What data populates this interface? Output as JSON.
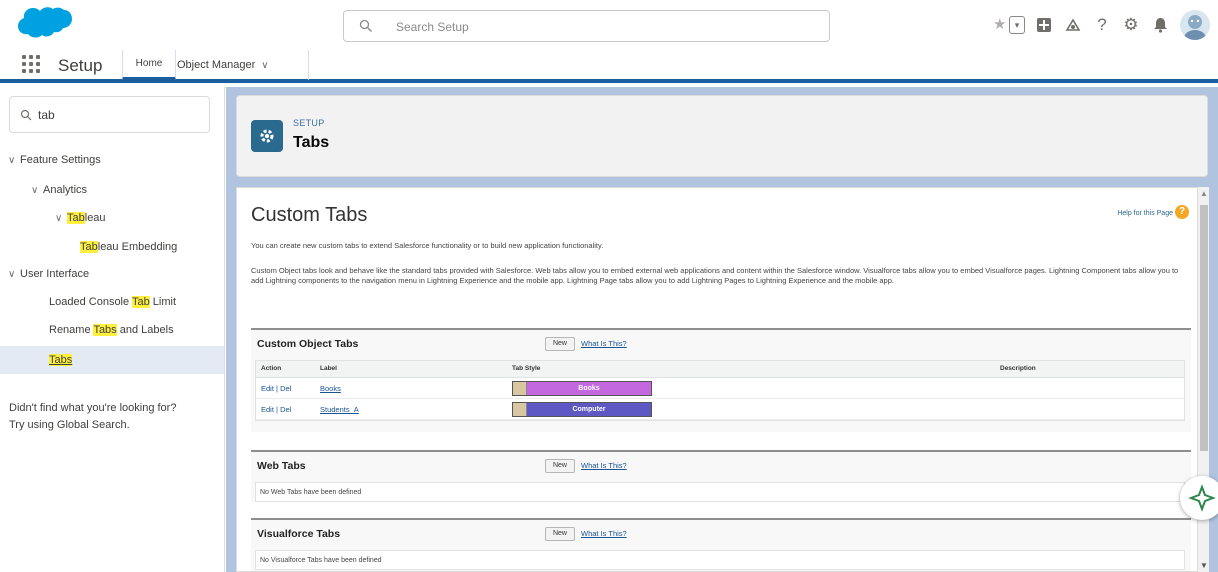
{
  "header": {
    "search_placeholder": "Search Setup",
    "icons": [
      "favorites-star-icon",
      "favorites-dropdown-icon",
      "global-actions-icon",
      "trailhead-icon",
      "help-icon",
      "setup-gear-icon",
      "notifications-bell-icon",
      "user-avatar"
    ]
  },
  "nav": {
    "app_name": "Setup",
    "tabs": [
      {
        "label": "Home"
      },
      {
        "label": "Object Manager"
      }
    ]
  },
  "sidebar": {
    "quick_find_value": "tab",
    "tree": [
      {
        "label": "Feature Settings",
        "level": 0,
        "expanded": true
      },
      {
        "label": "Analytics",
        "level": 1,
        "expanded": true
      },
      {
        "label_hl": "Tab",
        "label_rest": "leau",
        "level": 2,
        "expanded": true
      },
      {
        "label_hl": "Tab",
        "label_rest": "leau Embedding",
        "level": 3
      },
      {
        "label": "User Interface",
        "level": 0,
        "expanded": true
      },
      {
        "label_pre": "Loaded Console ",
        "label_hl": "Tab",
        "label_rest": " Limit",
        "level": 1
      },
      {
        "label_pre": "Rename ",
        "label_hl": "Tabs",
        "label_rest": " and Labels",
        "level": 1
      },
      {
        "label_hl": "Tabs",
        "level": 1,
        "selected": true
      }
    ],
    "not_found_line1": "Didn't find what you're looking for?",
    "not_found_line2": "Try using Global Search."
  },
  "page_header": {
    "eyebrow": "SETUP",
    "title": "Tabs"
  },
  "content": {
    "title": "Custom Tabs",
    "help_link": "Help for this Page",
    "intro1": "You can create new custom tabs to extend Salesforce functionality or to build new application functionality.",
    "intro2": "Custom Object tabs look and behave like the standard tabs provided with Salesforce. Web tabs allow you to embed external web applications and content within the Salesforce window. Visualforce tabs allow you to embed Visualforce pages. Lightning Component tabs allow you to add Lightning components to the navigation menu in Lightning Experience and the mobile app. Lightning Page tabs allow you to add Lightning Pages to Lightning Experience and the mobile app.",
    "sections": {
      "custom_object": {
        "name": "Custom Object Tabs",
        "new_label": "New",
        "what_label": "What Is This?",
        "columns": {
          "action": "Action",
          "label": "Label",
          "style": "Tab Style",
          "description": "Description"
        },
        "rows": [
          {
            "edit": "Edit",
            "sep": " | ",
            "del": "Del",
            "label": "Books",
            "style_name": "Books",
            "style_color": "#c468e0"
          },
          {
            "edit": "Edit",
            "sep": " | ",
            "del": "Del",
            "label": "Students_A",
            "style_name": "Computer",
            "style_color": "#5e58c4"
          }
        ]
      },
      "web": {
        "name": "Web Tabs",
        "new_label": "New",
        "what_label": "What Is This?",
        "empty": "No Web Tabs have been defined"
      },
      "visualforce": {
        "name": "Visualforce Tabs",
        "new_label": "New",
        "what_label": "What Is This?",
        "empty": "No Visualforce Tabs have been defined"
      }
    }
  },
  "colors": {
    "brand_blue": "#00a1e0",
    "nav_accent": "#1b5fa0",
    "highlight": "#fff03f",
    "setup_icon_bg": "#2a6a8e"
  }
}
